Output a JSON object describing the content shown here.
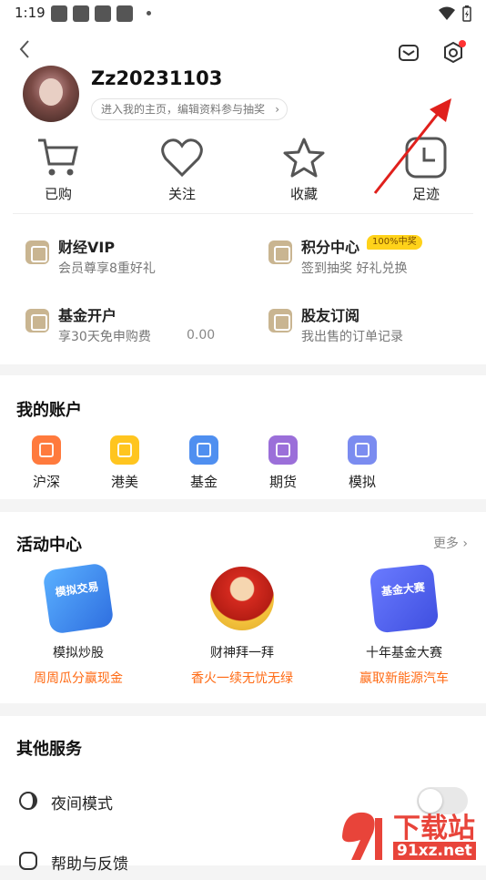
{
  "status_bar": {
    "time": "1:19"
  },
  "header": {
    "username": "Zz20231103",
    "profile_link": "进入我的主页，编辑资料参与抽奖"
  },
  "quick_actions": [
    {
      "label": "已购",
      "icon": "cart-icon"
    },
    {
      "label": "关注",
      "icon": "heart-icon"
    },
    {
      "label": "收藏",
      "icon": "star-icon"
    },
    {
      "label": "足迹",
      "icon": "clock-icon"
    }
  ],
  "services": [
    {
      "title": "财经VIP",
      "subtitle": "会员尊享8重好礼"
    },
    {
      "title": "积分中心",
      "subtitle": "签到抽奖 好礼兑换",
      "badge": "100%中奖"
    },
    {
      "title": "基金开户",
      "subtitle": "享30天免申购费",
      "amount": "0.00"
    },
    {
      "title": "股友订阅",
      "subtitle": "我出售的订单记录"
    }
  ],
  "accounts": {
    "title": "我的账户",
    "items": [
      {
        "label": "沪深",
        "color": "#ff7a3d"
      },
      {
        "label": "港美",
        "color": "#ffc51f"
      },
      {
        "label": "基金",
        "color": "#4f8ff0"
      },
      {
        "label": "期货",
        "color": "#9b6fd9"
      },
      {
        "label": "模拟",
        "color": "#7b8cf0"
      }
    ]
  },
  "activities": {
    "title": "活动中心",
    "more": "更多",
    "items": [
      {
        "name": "模拟炒股",
        "sub": "周周瓜分赢现金",
        "pic_text": "模拟交易"
      },
      {
        "name": "财神拜一拜",
        "sub": "香火一续无忧无绿",
        "pic_text": ""
      },
      {
        "name": "十年基金大赛",
        "sub": "赢取新能源汽车",
        "pic_text": "基金大赛"
      }
    ]
  },
  "other": {
    "title": "其他服务",
    "rows": [
      {
        "label": "夜间模式"
      },
      {
        "label": "帮助与反馈"
      }
    ]
  },
  "watermark": {
    "text": "下载站",
    "url": "91xz.net"
  }
}
